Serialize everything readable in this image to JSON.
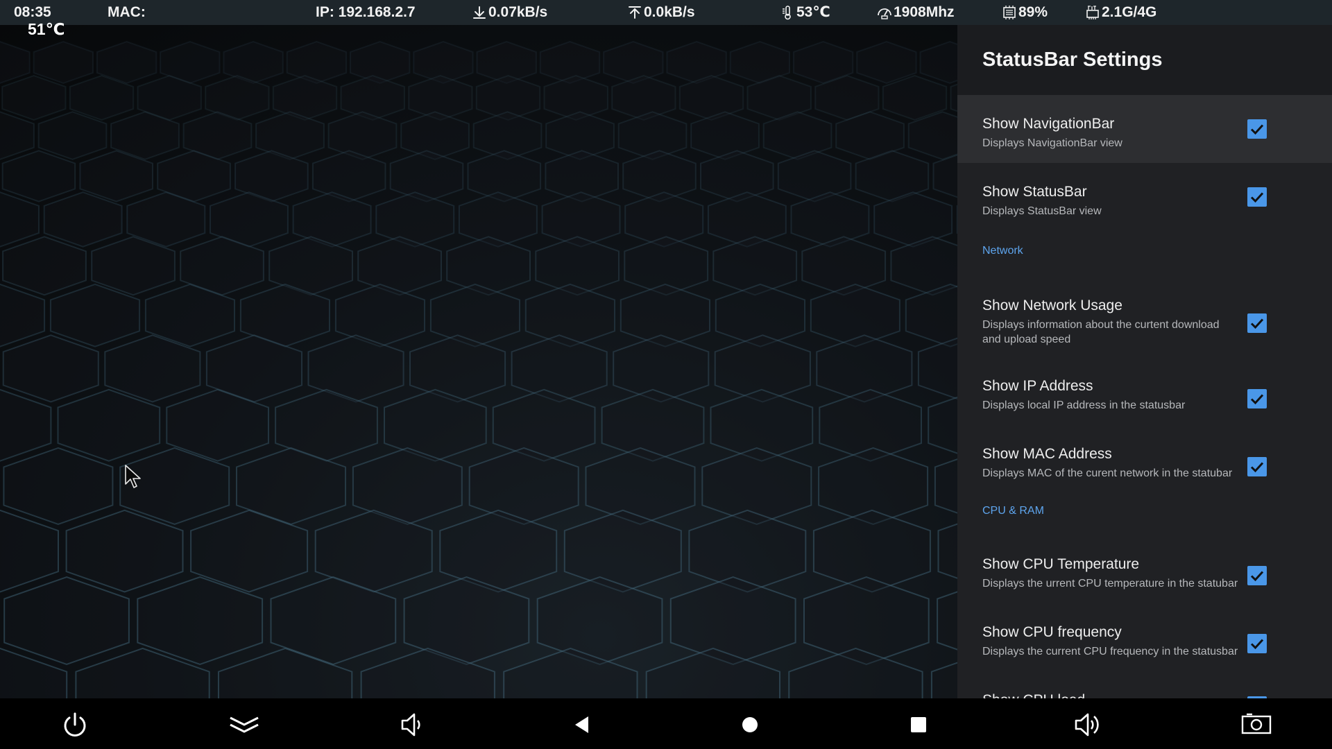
{
  "statusbar": {
    "time": "08:35",
    "mac": "MAC:",
    "ip": "IP: 192.168.2.7",
    "download": "0.07kB/s",
    "upload": "0.0kB/s",
    "cpu_temp": "53℃",
    "cpu_freq": "1908Mhz",
    "cpu_load": "89%",
    "ram": "2.1G/4G",
    "icons": [
      "download-arrow-icon",
      "upload-arrow-icon",
      "thermometer-icon",
      "cpu-gauge-icon",
      "cpu-chip-icon",
      "ram-chip-icon"
    ]
  },
  "overlay": {
    "temperature": "51℃"
  },
  "settings": {
    "title": "StatusBar Settings",
    "items": [
      {
        "title": "Show NavigationBar",
        "summary": "Displays NavigationBar view",
        "checked": true
      },
      {
        "title": "Show StatusBar",
        "summary": "Displays StatusBar view",
        "checked": true
      },
      {
        "title": "Show Network Usage",
        "summary": "Displays information about the curtent download and upload speed",
        "checked": true
      },
      {
        "title": "Show IP Address",
        "summary": "Displays local IP address in the statusbar",
        "checked": true
      },
      {
        "title": "Show MAC Address",
        "summary": "Displays MAC of the curent network in the statubar",
        "checked": true
      },
      {
        "title": "Show CPU Temperature",
        "summary": "Displays the urrent CPU temperature in the statubar",
        "checked": true
      },
      {
        "title": "Show CPU frequency",
        "summary": "Displays the current CPU frequency in the statusbar",
        "checked": true
      },
      {
        "title": "Show CPU load",
        "summary": "",
        "checked": true
      }
    ],
    "categories": {
      "network": "Network",
      "cpu_ram": "CPU & RAM"
    }
  },
  "navbar": {
    "buttons": [
      "power-icon",
      "collapse-chevrons-icon",
      "volume-down-icon",
      "back-icon",
      "home-icon",
      "recents-icon",
      "volume-up-icon",
      "screenshot-icon"
    ]
  },
  "colors": {
    "statusbar_bg": "#1e262b",
    "panel_bg": "#202124",
    "panel_header_bg": "#1b1c1f",
    "highlight_bg": "#2d2e31",
    "accent": "#4a97e8",
    "category_text": "#5ea5ee"
  }
}
